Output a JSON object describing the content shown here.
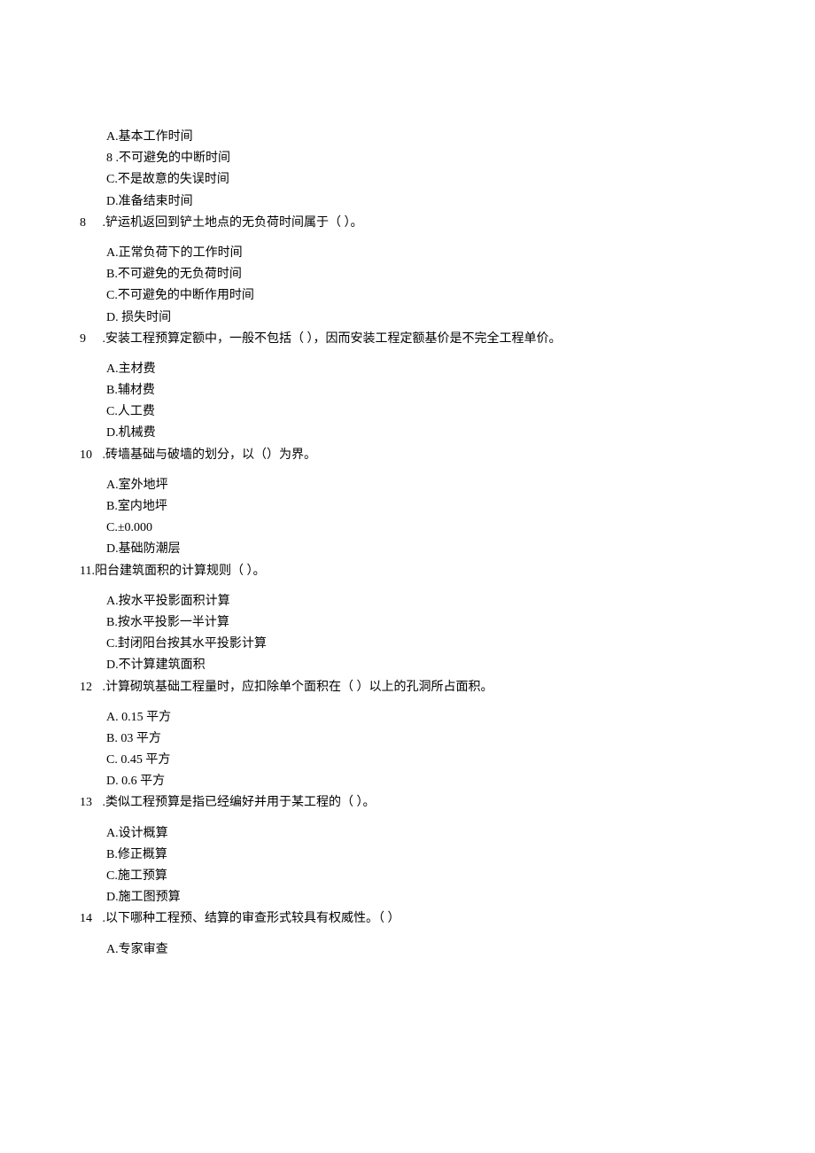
{
  "q7_options": {
    "a": "A.基本工作时间",
    "b": "8   .不可避免的中断时间",
    "c": "C.不是故意的失误时间",
    "d": "D.准备结束时间"
  },
  "q8": {
    "num": "8",
    "text": "  .铲运机返回到铲土地点的无负荷时间属于（            ）。",
    "a": "A.正常负荷下的工作时间",
    "b": "B.不可避免的无负荷时间",
    "c": "C.不可避免的中断作用时间",
    "d": "D. 损失时间"
  },
  "q9": {
    "num": "9",
    "text": "  .安装工程预算定额中，一般不包括（          ），因而安装工程定额基价是不完全工程单价。",
    "a": "A.主材费",
    "b": "B.辅材费",
    "c": "C.人工费",
    "d": "D.机械费"
  },
  "q10": {
    "num": "10",
    "text": "  .砖墙基础与破墙的划分，以（）为界。",
    "a": "A.室外地坪",
    "b": "B.室内地坪",
    "c": "C.±0.000",
    "d": "D.基础防潮层"
  },
  "q11": {
    "text": "11.阳台建筑面积的计算规则（            ）。",
    "a": "A.按水平投影面积计算",
    "b": "B.按水平投影一半计算",
    "c": "C.封闭阳台按其水平投影计算",
    "d": "D.不计算建筑面积"
  },
  "q12": {
    "num": "12",
    "text": "  .计算砌筑基础工程量时，应扣除单个面积在（           ）以上的孔洞所占面积。",
    "a": "A.   0.15 平方",
    "b": "B.   03 平方",
    "c": "C.   0.45 平方",
    "d": "D.   0.6 平方"
  },
  "q13": {
    "num": "13",
    "text": "  .类似工程预算是指已经编好并用于某工程的（           ）。",
    "a": "A.设计概算",
    "b": "B.修正概算",
    "c": "C.施工预算",
    "d": "D.施工图预算"
  },
  "q14": {
    "num": "14",
    "text": "  .以下哪种工程预、结算的审查形式较具有权威性。（          ）",
    "a": "A.专家审查"
  }
}
